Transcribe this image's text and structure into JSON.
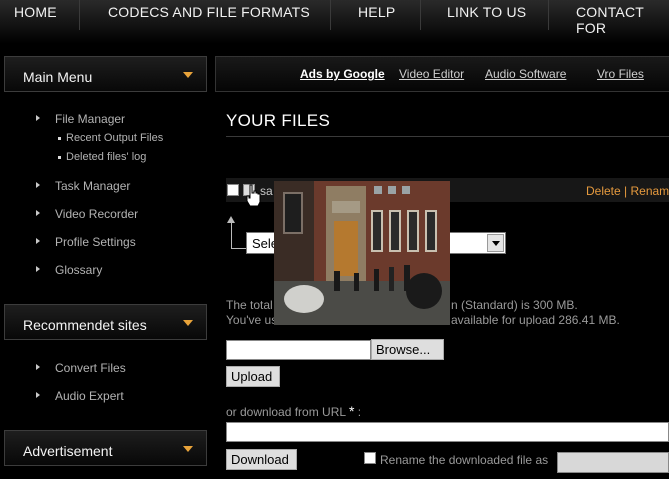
{
  "nav": {
    "items": [
      "HOME",
      "CODECS AND FILE FORMATS",
      "HELP",
      "LINK TO US",
      "CONTACT FOR"
    ]
  },
  "sidebar": {
    "main_menu": {
      "title": "Main Menu",
      "items": [
        {
          "label": "File Manager",
          "sub": [
            "Recent Output Files",
            "Deleted files' log"
          ]
        },
        {
          "label": "Task Manager"
        },
        {
          "label": "Video Recorder"
        },
        {
          "label": "Profile Settings"
        },
        {
          "label": "Glossary"
        }
      ]
    },
    "recommended": {
      "title": "Recommendet sites",
      "items": [
        "Convert Files",
        "Audio Expert"
      ]
    },
    "advertisement": {
      "title": "Advertisement"
    }
  },
  "adbar": {
    "ads_label": "Ads by Google",
    "links": [
      "Video Editor",
      "Audio Software",
      "Vro Files"
    ]
  },
  "files": {
    "title": "YOUR FILES",
    "row": {
      "name_fragment": "sa",
      "actions": "Delete | Renam"
    },
    "select_value": "Sele",
    "info_line1_start": "The total",
    "info_line1_end": "n (Standard) is 300 MB.",
    "info_line2_start": "You've us",
    "info_line2_end": "available for upload 286.41 MB."
  },
  "upload": {
    "browse_label": "Browse...",
    "upload_label": "Upload",
    "url_label": "or download from URL",
    "url_required_mark": "*",
    "url_label_colon": " :",
    "download_label": "Download",
    "rename_label": "Rename the downloaded file as"
  },
  "colors": {
    "accent": "#e69a3e",
    "background": "#000000"
  },
  "icons": {
    "cursor": "hand-pointer-icon",
    "menu_arrow": "chevron-down-icon",
    "bullet": "triangle-right-icon"
  }
}
